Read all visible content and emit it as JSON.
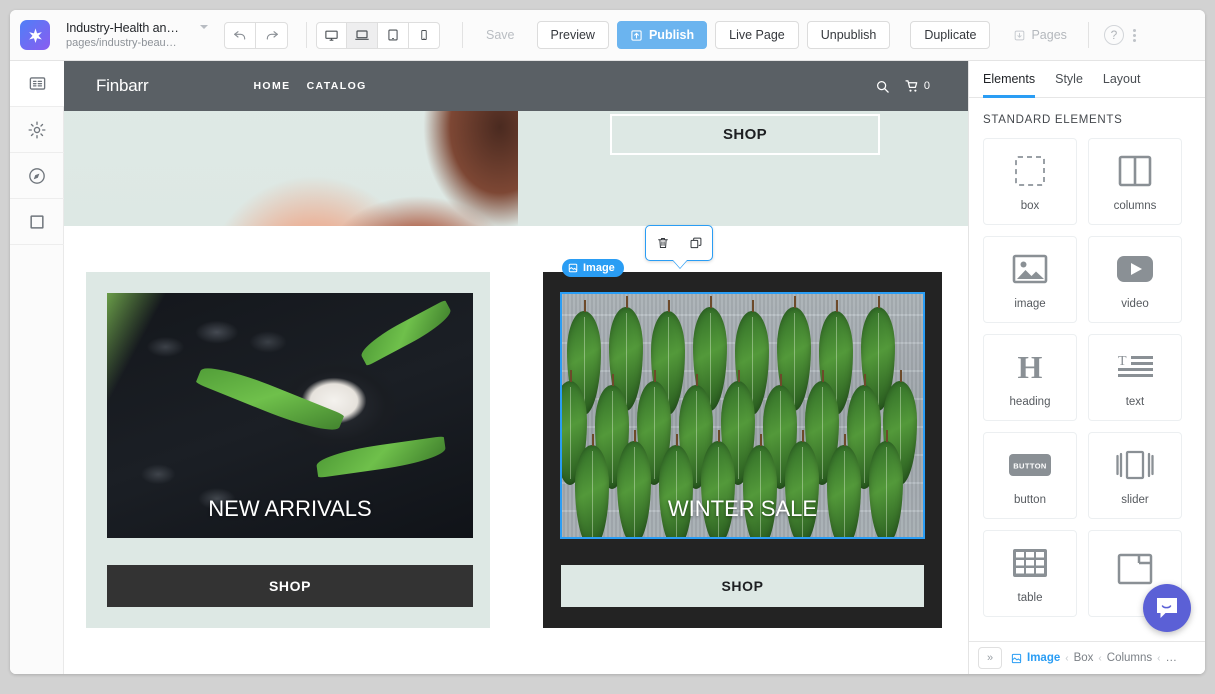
{
  "topbar": {
    "logo_icon": "star-burst-icon",
    "page_title": "Industry-Health an…",
    "page_path": "pages/industry-beau…",
    "undo_icon": "undo-icon",
    "redo_icon": "redo-icon",
    "devices": [
      {
        "name": "desktop",
        "icon": "desktop-icon",
        "active": false
      },
      {
        "name": "laptop",
        "icon": "laptop-icon",
        "active": true
      },
      {
        "name": "tablet",
        "icon": "tablet-icon",
        "active": false
      },
      {
        "name": "mobile",
        "icon": "mobile-icon",
        "active": false
      }
    ],
    "save_label": "Save",
    "preview_label": "Preview",
    "publish_label": "Publish",
    "publish_icon": "publish-upload-icon",
    "live_page_label": "Live Page",
    "unpublish_label": "Unpublish",
    "duplicate_label": "Duplicate",
    "pages_label": "Pages",
    "pages_icon": "download-arrow-icon",
    "help_label": "?",
    "more_icon": "kebab-menu-icon",
    "accent_blue": "#6bb4ef"
  },
  "rail": {
    "items": [
      {
        "name": "pages-panel",
        "icon": "list-panel-icon",
        "active": true
      },
      {
        "name": "settings",
        "icon": "gear-icon",
        "active": false
      },
      {
        "name": "navigator",
        "icon": "compass-icon",
        "active": false
      },
      {
        "name": "box-tool",
        "icon": "square-icon",
        "active": false
      }
    ]
  },
  "canvas": {
    "site_header": {
      "logo": "Finbarr",
      "nav": [
        "HOME",
        "CATALOG"
      ],
      "search_icon": "search-icon",
      "cart_icon": "cart-icon",
      "cart_count": "0",
      "background": "#5a6065"
    },
    "hero": {
      "background": "#dde8e4",
      "photo_alt": "woman-shoulder-photo",
      "shop_label": "SHOP"
    },
    "cards": [
      {
        "name": "new-arrivals-card",
        "background": "#dde8e4",
        "photo_alt": "cream-jar-with-aloe-on-black-stones",
        "caption": "NEW ARRIVALS",
        "cta_label": "SHOP",
        "cta_background": "#333333",
        "cta_color": "#ffffff",
        "selected": false
      },
      {
        "name": "winter-sale-card",
        "background": "#232323",
        "photo_alt": "green-leaves-on-grey-wood",
        "caption": "WINTER SALE",
        "cta_label": "SHOP",
        "cta_background": "#dde8e4",
        "cta_color": "#1d1f22",
        "selected": true
      }
    ],
    "selection": {
      "badge_label": "Image",
      "badge_icon": "image-element-icon",
      "badge_color": "#2a9df4",
      "toolbar": [
        {
          "name": "delete",
          "icon": "trash-icon"
        },
        {
          "name": "duplicate",
          "icon": "duplicate-icon"
        }
      ]
    }
  },
  "panel": {
    "tabs": [
      {
        "label": "Elements",
        "active": true
      },
      {
        "label": "Style",
        "active": false
      },
      {
        "label": "Layout",
        "active": false
      }
    ],
    "section_title": "STANDARD ELEMENTS",
    "elements": [
      {
        "label": "box",
        "icon": "dashed-box-icon"
      },
      {
        "label": "columns",
        "icon": "two-columns-icon"
      },
      {
        "label": "image",
        "icon": "image-icon"
      },
      {
        "label": "video",
        "icon": "play-video-icon"
      },
      {
        "label": "heading",
        "icon": "heading-h-icon"
      },
      {
        "label": "text",
        "icon": "text-lines-icon"
      },
      {
        "label": "button",
        "icon": "button-icon",
        "icon_text": "BUTTON"
      },
      {
        "label": "slider",
        "icon": "slider-icon"
      },
      {
        "label": "table",
        "icon": "table-grid-icon"
      },
      {
        "label": "",
        "icon": "layout-icon"
      }
    ],
    "footer": {
      "expand_icon": "double-chevron-right-icon",
      "breadcrumb_icon": "image-element-icon",
      "breadcrumb": [
        "Image",
        "Box",
        "Columns",
        "…"
      ],
      "current_color": "#2a9df4"
    }
  },
  "intercom": {
    "name": "chat-launcher",
    "icon": "chat-smile-icon",
    "color": "#5b60d6"
  }
}
